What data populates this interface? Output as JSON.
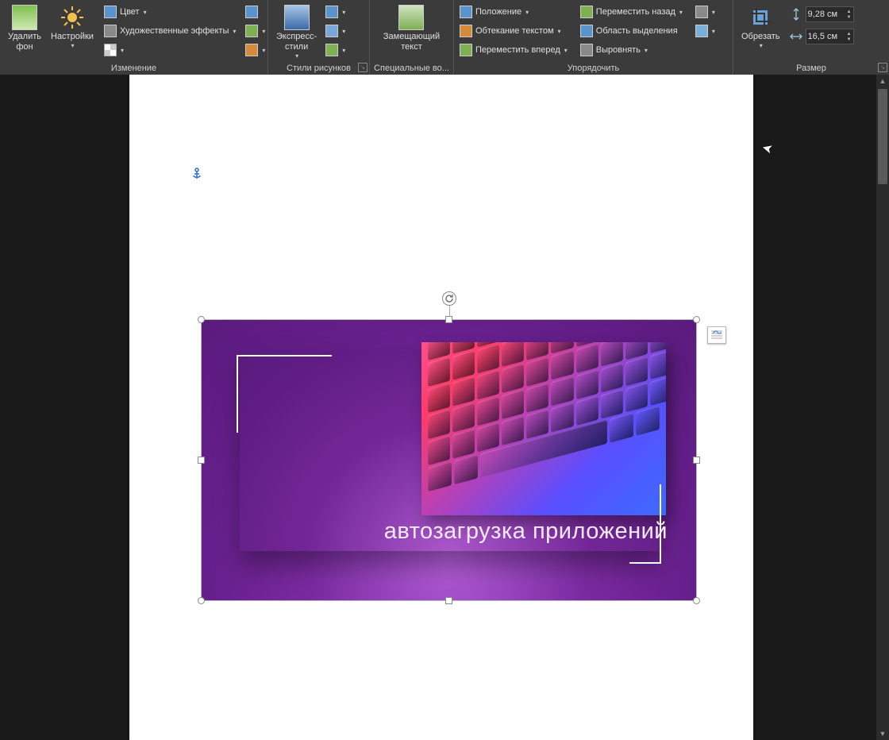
{
  "ribbon": {
    "groups": {
      "adjust": {
        "label": "Изменение",
        "remove_bg": "Удалить\nфон",
        "corrections": "Настройки",
        "color": "Цвет",
        "artistic": "Художественные эффекты"
      },
      "styles": {
        "label": "Стили рисунков",
        "quick_styles": "Экспресс-\nстили"
      },
      "accessibility": {
        "label": "Специальные во...",
        "alt_text": "Замещающий\nтекст"
      },
      "arrange": {
        "label": "Упорядочить",
        "position": "Положение",
        "wrap": "Обтекание текстом",
        "bring_forward": "Переместить вперед",
        "send_backward": "Переместить назад",
        "selection_pane": "Область выделения",
        "align": "Выровнять"
      },
      "size": {
        "label": "Размер",
        "crop": "Обрезать",
        "height": "9,28 см",
        "width": "16,5 см"
      }
    }
  },
  "document": {
    "image_caption": "автозагрузка приложений"
  }
}
